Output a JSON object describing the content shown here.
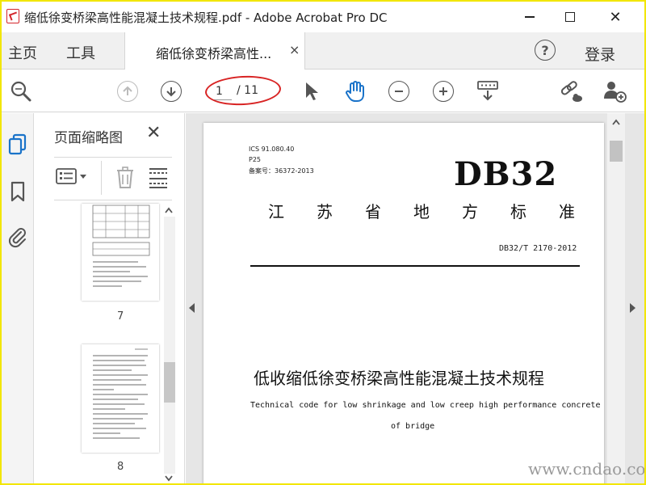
{
  "window": {
    "title": "缩低徐变桥梁高性能混凝土技术规程.pdf - Adobe Acrobat Pro DC",
    "minimize": "",
    "maximize": "",
    "close": "✕"
  },
  "tabs": {
    "home": "主页",
    "tools": "工具",
    "document": "缩低徐变桥梁高性...",
    "document_close": "×",
    "sign_in": "登录"
  },
  "toolbar": {
    "page_current": "1",
    "page_total": "/ 11",
    "accent": "#d82323"
  },
  "thumbnails": {
    "title": "页面缩略图",
    "close": "✕",
    "pages": [
      {
        "label": "7"
      },
      {
        "label": "8"
      }
    ]
  },
  "document": {
    "ics": "ICS 91.080.40",
    "category": "P25",
    "record": "备案号：36372-2013",
    "code_big": "DB32",
    "province_chars": [
      "江",
      "苏",
      "省",
      "地",
      "方",
      "标",
      "准"
    ],
    "std_number": "DB32/T 2170-2012",
    "title_cn": "低收缩低徐变桥梁高性能混凝土技术规程",
    "title_en_1": "Technical code for low shrinkage and low creep high performance concrete",
    "title_en_2": "of bridge"
  },
  "watermark": "www.cndao.com"
}
